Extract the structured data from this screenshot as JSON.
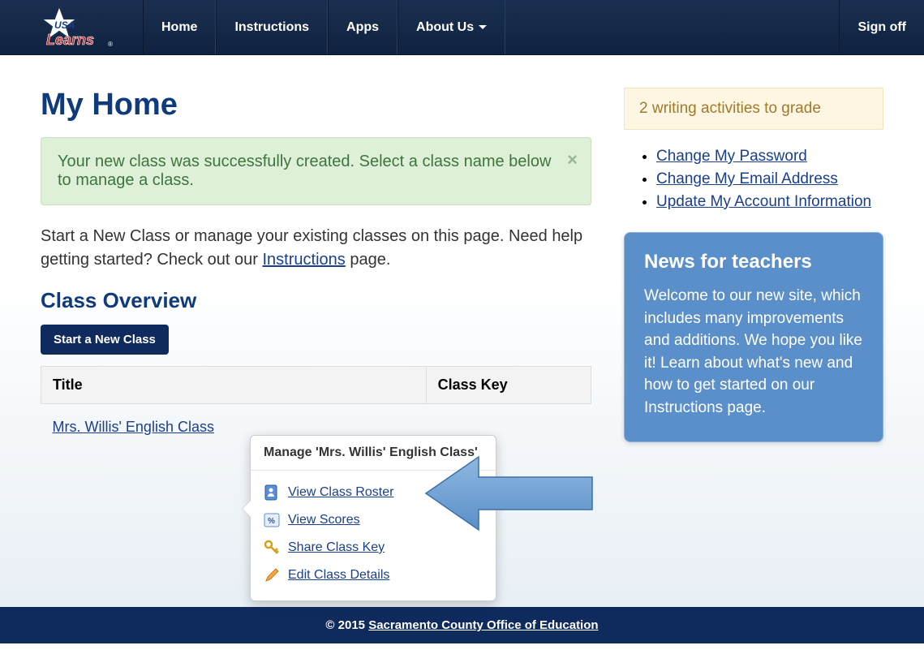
{
  "nav": {
    "home": "Home",
    "instructions": "Instructions",
    "apps": "Apps",
    "about": "About Us",
    "signoff": "Sign off"
  },
  "page_title": "My Home",
  "alert": {
    "text": "Your new class was successfully created. Select a class name below to manage a class."
  },
  "intro": {
    "part1": "Start a New Class or manage your existing classes on this page. Need help getting started? Check out our ",
    "link": "Instructions",
    "part2": " page."
  },
  "section_title": "Class Overview",
  "new_class_btn": "Start a New Class",
  "table": {
    "col_title": "Title",
    "col_key": "Class Key",
    "row_class_name": "Mrs. Willis' English Class"
  },
  "popover": {
    "title": "Manage 'Mrs. Willis' English Class'",
    "items": {
      "roster": "View Class Roster",
      "scores": "View Scores",
      "share": "Share Class Key",
      "edit": "Edit Class Details"
    }
  },
  "notification": "2 writing activities to grade",
  "account_links": {
    "password": "Change My Password",
    "email": "Change My Email Address",
    "info": "Update My Account Information"
  },
  "news": {
    "title": "News for teachers",
    "body": "Welcome to our new site, which includes many improvements and additions. We hope you like it! Learn about what's new and how to get started on our Instructions page."
  },
  "footer": {
    "prefix": "© 2015 ",
    "link": "Sacramento County Office of Education"
  }
}
